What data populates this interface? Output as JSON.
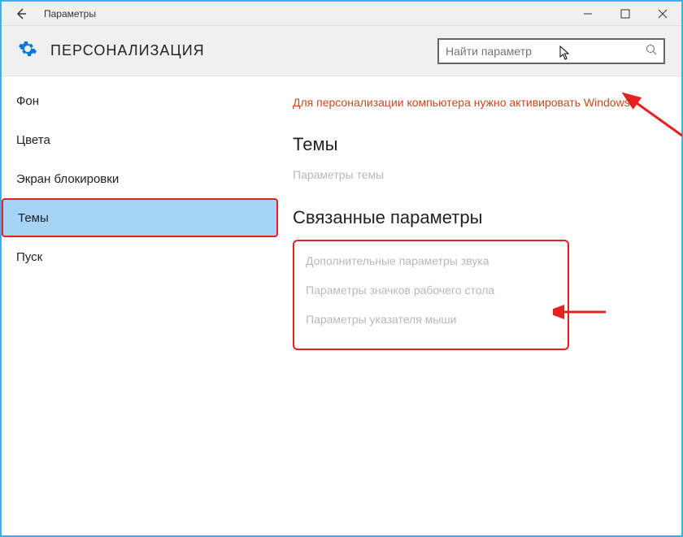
{
  "titlebar": {
    "title": "Параметры"
  },
  "header": {
    "title": "ПЕРСОНАЛИЗАЦИЯ",
    "search_placeholder": "Найти параметр"
  },
  "sidebar": {
    "items": [
      {
        "label": "Фон",
        "selected": false
      },
      {
        "label": "Цвета",
        "selected": false
      },
      {
        "label": "Экран блокировки",
        "selected": false
      },
      {
        "label": "Темы",
        "selected": true
      },
      {
        "label": "Пуск",
        "selected": false
      }
    ]
  },
  "content": {
    "warning": "Для персонализации компьютера нужно активировать Windows.",
    "section_themes": "Темы",
    "theme_settings_link": "Параметры темы",
    "section_related": "Связанные параметры",
    "related": [
      "Дополнительные параметры звука",
      "Параметры значков рабочего стола",
      "Параметры указателя мыши"
    ]
  }
}
